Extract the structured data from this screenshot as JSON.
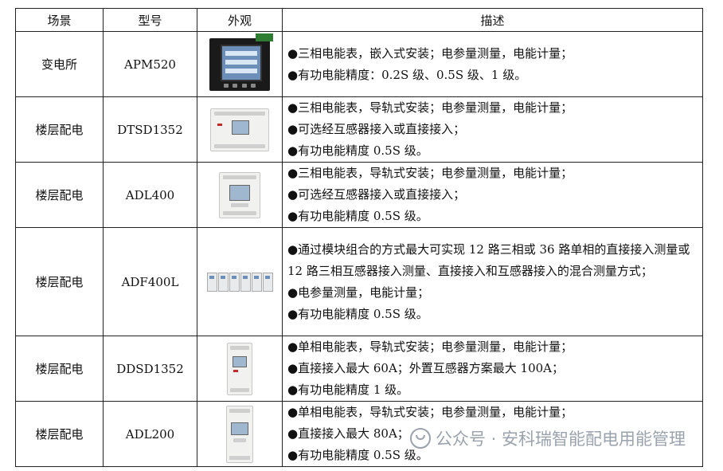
{
  "headers": [
    "场景",
    "型号",
    "外观",
    "描述"
  ],
  "rows": [
    {
      "scene": "变电所",
      "model": "APM520",
      "image_icon": "panel-meter-image",
      "desc": [
        "●三相电能表，嵌入式安装；电参量测量，电能计量；",
        "●有功电能精度：0.2S 级、0.5S 级、1 级。"
      ]
    },
    {
      "scene": "楼层配电",
      "model": "DTSD1352",
      "image_icon": "din-rail-meter-image",
      "desc": [
        "●三相电能表，导轨式安装；电参量测量，电能计量；",
        "●可选经互感器接入或直接接入；",
        "●有功电能精度 0.5S 级。"
      ]
    },
    {
      "scene": "楼层配电",
      "model": "ADL400",
      "image_icon": "din-rail-meter-image",
      "desc": [
        "●三相电能表，导轨式安装；电参量测量，电能计量；",
        "●可选经互感器接入或直接接入；",
        "●有功电能精度 0.5S 级。"
      ]
    },
    {
      "scene": "楼层配电",
      "model": "ADF400L",
      "image_icon": "modular-meter-image",
      "desc": [
        "●通过模块组合的方式最大可实现 12 路三相或 36 路单相的直接接入测量或 12 路三相互感器接入测量、直接接入和互感器接入的混合测量方式；",
        "●电参量测量，电能计量；",
        "●有功电能精度 0.5S 级。"
      ]
    },
    {
      "scene": "楼层配电",
      "model": "DDSD1352",
      "image_icon": "single-phase-meter-image",
      "desc": [
        "●单相电能表，导轨式安装；电参量测量，电能计量；",
        "●直接接入最大 60A；外置互感器方案最大 100A；",
        "●有功电能精度 1 级。"
      ]
    },
    {
      "scene": "楼层配电",
      "model": "ADL200",
      "image_icon": "single-phase-meter-image",
      "desc": [
        "●单相电能表，导轨式安装；电参量测量，电能计量；",
        "●直接接入最大 80A；",
        "●有功电能精度 0.5S 级。"
      ]
    }
  ],
  "watermark": "公众号 · 安科瑞智能配电用能管理",
  "watermark_icon": "wechat-icon"
}
